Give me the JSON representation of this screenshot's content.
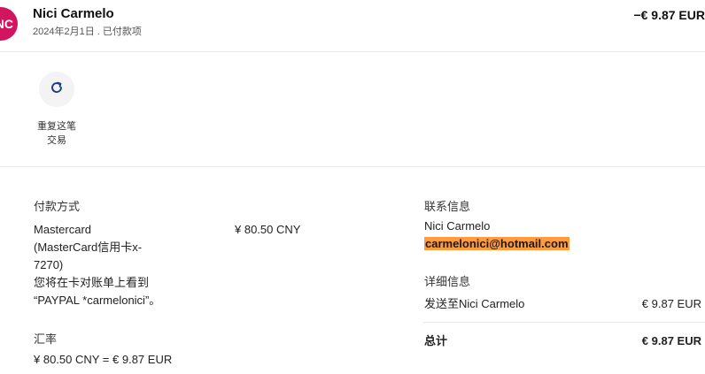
{
  "header": {
    "avatar_initials": "NC",
    "merchant_name": "Nici Carmelo",
    "subtitle": "2024年2月1日 . 已付款项",
    "amount": "−€ 9.87 EUR"
  },
  "actions": {
    "repeat_icon": "refresh-icon",
    "repeat_label_line1": "重复这笔",
    "repeat_label_line2": "交易"
  },
  "payment": {
    "section_title": "付款方式",
    "method_lines": [
      "Mastercard",
      "(MasterCard信用卡x-",
      "7270)",
      "您将在卡对账单上看到",
      "“PAYPAL *carmelonici”。"
    ],
    "amount": "¥ 80.50 CNY"
  },
  "exchange": {
    "section_title": "汇率",
    "rate_line": "¥ 80.50 CNY = € 9.87 EUR"
  },
  "contact": {
    "section_title": "联系信息",
    "name": "Nici Carmelo",
    "email": "carmelonici@hotmail.com",
    "highlight_color": "#ff9a3d"
  },
  "details": {
    "section_title": "详细信息",
    "sent_to_label": "发送至Nici Carmelo",
    "sent_to_amount": "€ 9.87 EUR",
    "total_label": "总计",
    "total_amount": "€ 9.87 EUR"
  },
  "colors": {
    "avatar": "#d2155f",
    "repeat_icon": "#1f3c8a"
  }
}
